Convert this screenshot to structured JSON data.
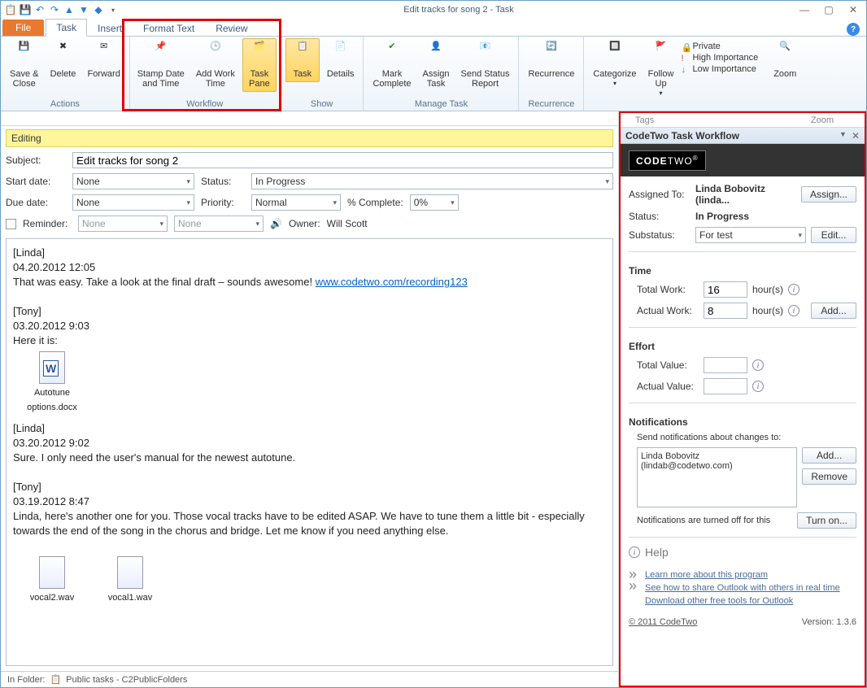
{
  "window": {
    "title": "Edit tracks for song 2  -  Task"
  },
  "qat": [
    "💾",
    "↶",
    "↷",
    "▲",
    "▼",
    "◆",
    "▾"
  ],
  "tabs": {
    "file": "File",
    "items": [
      "Task",
      "Insert",
      "Format Text",
      "Review"
    ],
    "active": 0
  },
  "ribbon": {
    "actions": {
      "label": "Actions",
      "save_close": "Save &\nClose",
      "delete": "Delete",
      "forward": "Forward"
    },
    "workflow": {
      "label": "Workflow",
      "stamp": "Stamp Date\nand Time",
      "addwork": "Add Work\nTime",
      "taskpane": "Task\nPane"
    },
    "show": {
      "label": "Show",
      "task": "Task",
      "details": "Details"
    },
    "manage": {
      "label": "Manage Task",
      "mark": "Mark\nComplete",
      "assign": "Assign\nTask",
      "status": "Send Status\nReport"
    },
    "recurrence": {
      "label": "Recurrence",
      "btn": "Recurrence"
    },
    "tags": {
      "label": "Tags",
      "categorize": "Categorize",
      "followup": "Follow\nUp",
      "private": "Private",
      "high": "High Importance",
      "low": "Low Importance"
    },
    "zoomg": {
      "label": "Zoom",
      "zoom": "Zoom"
    },
    "hidden_tags": "Tags",
    "hidden_zoom": "Zoom"
  },
  "editing_bar": "Editing",
  "form": {
    "subject_label": "Subject:",
    "subject": "Edit tracks for song 2",
    "startdate_label": "Start date:",
    "startdate": "None",
    "duedate_label": "Due date:",
    "duedate": "None",
    "status_label": "Status:",
    "status": "In Progress",
    "priority_label": "Priority:",
    "priority": "Normal",
    "complete_label": "% Complete:",
    "complete": "0%",
    "reminder_label": "Reminder:",
    "reminder_date": "None",
    "reminder_time": "None",
    "owner_label": "Owner:",
    "owner": "Will Scott"
  },
  "notes": {
    "b1_author": "[Linda]",
    "b1_date": "04.20.2012 12:05",
    "b1_text": "That was easy. Take a look at the final draft – sounds awesome!",
    "b1_link": "www.codetwo.com/recording123",
    "b2_author": "[Tony]",
    "b2_date": "03.20.2012 9:03",
    "b2_text": "Here it is:",
    "att1": "Autotune options.docx",
    "b3_author": "[Linda]",
    "b3_date": "03.20.2012 9:02",
    "b3_text": "Sure. I only need the user's manual for the newest autotune.",
    "b4_author": "[Tony]",
    "b4_date": "03.19.2012 8:47",
    "b4_text": "Linda, here's another one for you. Those vocal tracks have to be edited ASAP. We have to tune them a little bit - especially towards the end of the song in the chorus and bridge. Let me know if you need anything else.",
    "att2": "vocal2.wav",
    "att3": "vocal1.wav"
  },
  "statusbar": {
    "folder_label": "In Folder:",
    "folder": "Public tasks - C2PublicFolders"
  },
  "pane": {
    "title": "CodeTwo Task Workflow",
    "logo1": "CODE",
    "logo2": "TWO",
    "assigned_label": "Assigned To:",
    "assigned": "Linda Bobovitz (linda...",
    "assign_btn": "Assign...",
    "status_label": "Status:",
    "status": "In Progress",
    "substatus_label": "Substatus:",
    "substatus": "For test",
    "edit_btn": "Edit...",
    "time_h": "Time",
    "total_work_label": "Total Work:",
    "total_work": "16",
    "hours": "hour(s)",
    "actual_work_label": "Actual Work:",
    "actual_work": "8",
    "add_btn": "Add...",
    "effort_h": "Effort",
    "total_value_label": "Total Value:",
    "actual_value_label": "Actual Value:",
    "notif_h": "Notifications",
    "notif_sub": "Send notifications about changes to:",
    "notif_item": "Linda Bobovitz (lindab@codetwo.com)",
    "remove_btn": "Remove",
    "notif_off": "Notifications are turned off for this",
    "turnon_btn": "Turn on...",
    "help": "Help",
    "link1": "Learn more about this program",
    "link2": "See how to share Outlook with others in real time",
    "link3": "Download other free tools for Outlook",
    "copyright": "© 2011 CodeTwo",
    "version": "Version: 1.3.6"
  }
}
